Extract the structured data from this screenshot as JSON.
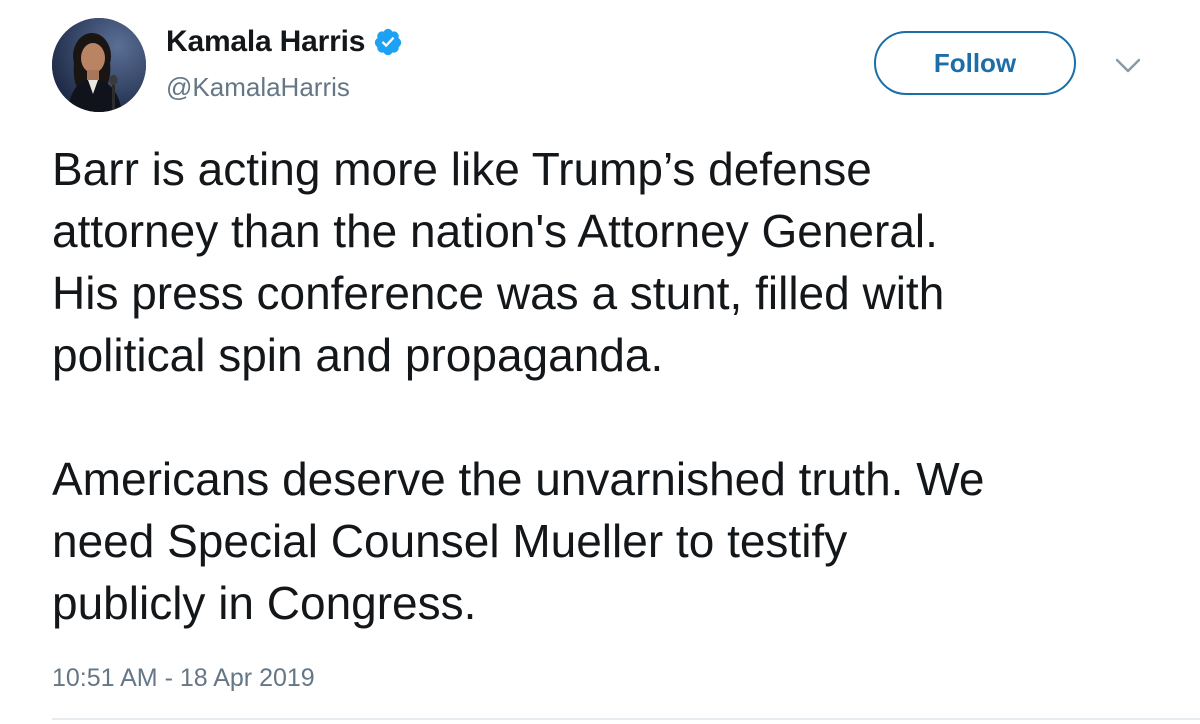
{
  "author": {
    "display_name": "Kamala Harris",
    "handle": "@KamalaHarris",
    "verified": true
  },
  "actions": {
    "follow_label": "Follow",
    "menu_icon": "chevron-down-icon"
  },
  "tweet": {
    "paragraph1_lines": [
      "Barr is acting more like Trump’s defense",
      "attorney than the nation's Attorney General.",
      "His press conference was a stunt, filled with",
      "political spin and propaganda."
    ],
    "paragraph2_lines": [
      "Americans deserve the unvarnished truth. We",
      "need Special Counsel Mueller to testify",
      "publicly in Congress."
    ],
    "timestamp": "10:51 AM - 18 Apr 2019"
  },
  "colors": {
    "text": "#14171a",
    "secondary": "#657786",
    "follow_blue": "#1b6ea8",
    "verified_blue": "#1da1f2",
    "divider": "#e6ecf0"
  }
}
